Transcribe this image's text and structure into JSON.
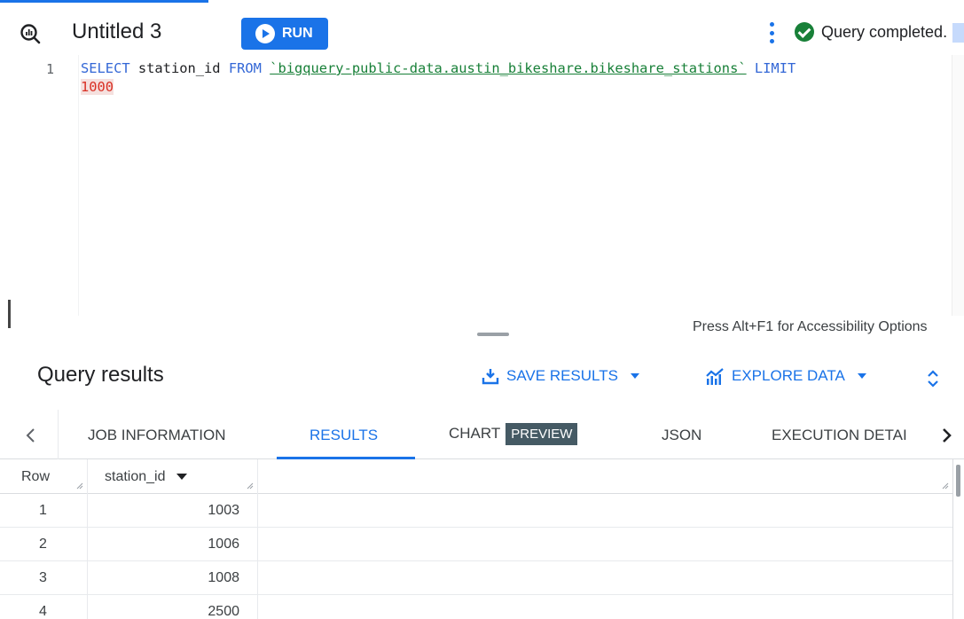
{
  "header": {
    "logo_icon": "bigquery-logo-icon",
    "tab_title": "Untitled 3",
    "run_label": "RUN",
    "more_icon": "more-vert-icon",
    "status_icon": "check-circle-icon",
    "status_text": "Query completed."
  },
  "editor": {
    "line_numbers": [
      "1"
    ],
    "code": {
      "kw_select": "SELECT",
      "column": " station_id ",
      "kw_from": "FROM",
      "space": " ",
      "table": "`bigquery-public-data.austin_bikeshare.bikeshare_stations`",
      "space2": " ",
      "kw_limit": "LIMIT",
      "limit_value": "1000"
    },
    "accessibility_hint": "Press Alt+F1 for Accessibility Options"
  },
  "results": {
    "title": "Query results",
    "save_results_label": "SAVE RESULTS",
    "save_icon": "download-icon",
    "explore_data_label": "EXPLORE DATA",
    "explore_icon": "insights-chart-icon",
    "expand_icon": "unfold-icon",
    "tabs": {
      "prev_icon": "chevron-left-icon",
      "job_information": "JOB INFORMATION",
      "results": "RESULTS",
      "chart": "CHART",
      "preview_badge": "PREVIEW",
      "json": "JSON",
      "execution_details": "EXECUTION DETAILS",
      "next_icon": "chevron-right-icon",
      "active": "RESULTS"
    },
    "table": {
      "columns": [
        "Row",
        "station_id"
      ],
      "sort_icon": "arrow-drop-down-icon",
      "rows": [
        {
          "row": "1",
          "station_id": "1003"
        },
        {
          "row": "2",
          "station_id": "1006"
        },
        {
          "row": "3",
          "station_id": "1008"
        },
        {
          "row": "4",
          "station_id": "2500"
        }
      ]
    }
  },
  "colors": {
    "accent": "#1a73e8",
    "success": "#188038",
    "keyword": "#3367d6",
    "string": "#188038",
    "number": "#d93025"
  }
}
